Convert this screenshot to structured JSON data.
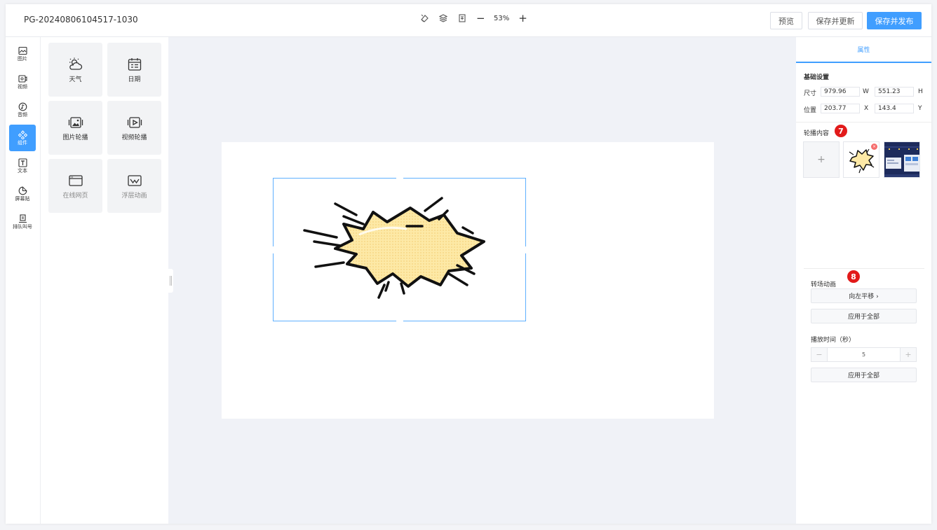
{
  "header": {
    "project_title": "PG-20240806104517-1030",
    "zoom": "53%",
    "zoom_out": "−",
    "zoom_in": "+",
    "preview_label": "预览",
    "save_update_label": "保存并更新",
    "save_publish_label": "保存并发布"
  },
  "sidebar": {
    "items": [
      {
        "label": "图片",
        "icon": "image-icon"
      },
      {
        "label": "视频",
        "icon": "video-icon"
      },
      {
        "label": "音频",
        "icon": "audio-icon"
      },
      {
        "label": "组件",
        "icon": "component-icon",
        "active": true
      },
      {
        "label": "文本",
        "icon": "text-icon"
      },
      {
        "label": "屏幕贴",
        "icon": "sticker-icon"
      },
      {
        "label": "排队叫号",
        "icon": "queue-icon"
      }
    ]
  },
  "components": {
    "items": [
      {
        "label": "天气",
        "icon": "weather-icon"
      },
      {
        "label": "日期",
        "icon": "calendar-icon"
      },
      {
        "label": "图片轮播",
        "icon": "image-carousel-icon"
      },
      {
        "label": "视频轮播",
        "icon": "video-carousel-icon"
      },
      {
        "label": "在线网页",
        "icon": "webpage-icon"
      },
      {
        "label": "浮层动画",
        "icon": "float-animation-icon"
      }
    ]
  },
  "properties": {
    "tab_label": "属性",
    "basic_title": "基础设置",
    "size_label": "尺寸",
    "width": "979.96",
    "width_axis": "W",
    "height": "551.23",
    "height_axis": "H",
    "position_label": "位置",
    "pos_x": "203.77",
    "x_axis": "X",
    "pos_y": "143.4",
    "y_axis": "Y",
    "carousel_title": "轮播内容",
    "badge_7": "7",
    "add_symbol": "+",
    "transition_title": "转场动画",
    "badge_8": "8",
    "transition_value": "向左平移  ›",
    "apply_all_1": "应用于全部",
    "duration_label": "播放时间（秒）",
    "duration_value": "5",
    "minus": "−",
    "plus": "+",
    "apply_all_2": "应用于全部"
  },
  "colors": {
    "accent": "#409eff",
    "badge": "#e21a1a",
    "burst_fill": "#fde9a6"
  }
}
